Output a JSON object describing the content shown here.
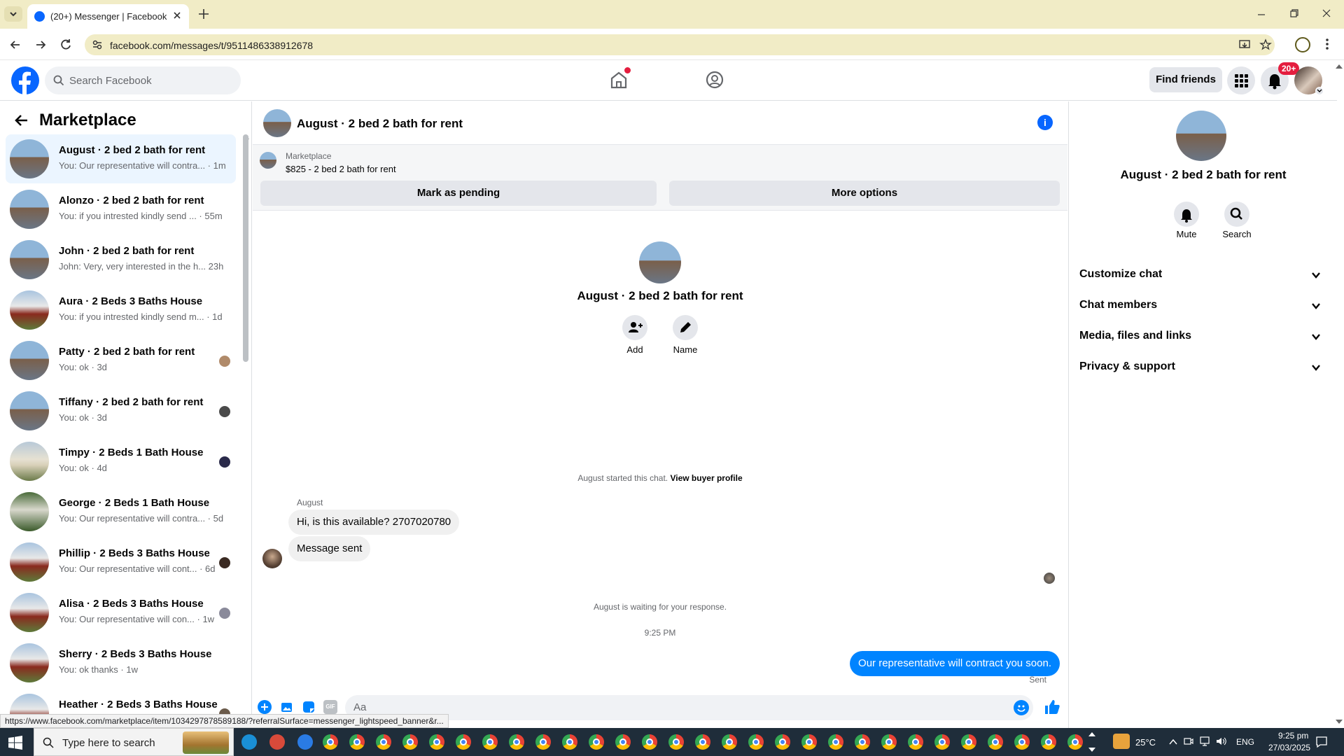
{
  "browser": {
    "tab_title": "(20+) Messenger | Facebook",
    "url": "facebook.com/messages/t/9511486338912678",
    "status_url": "https://www.facebook.com/marketplace/item/1034297878589188/?referralSurface=messenger_lightspeed_banner&r..."
  },
  "fb_header": {
    "search_placeholder": "Search Facebook",
    "find_friends": "Find friends",
    "notification_badge": "20+"
  },
  "left_panel": {
    "title": "Marketplace",
    "conversations": [
      {
        "name": "August · 2 bed 2 bath for rent",
        "preview": "You: Our representative will contra... · 1m"
      },
      {
        "name": "Alonzo · 2 bed 2 bath for rent",
        "preview": "You: if you intrested kindly send ... · 55m"
      },
      {
        "name": "John · 2 bed 2 bath for rent",
        "preview": "John: Very, very interested in the h... 23h"
      },
      {
        "name": "Aura · 2 Beds 3 Baths House",
        "preview": "You: if you intrested kindly send m... · 1d"
      },
      {
        "name": "Patty · 2 bed 2 bath for rent",
        "preview": "You: ok · 3d"
      },
      {
        "name": "Tiffany · 2 bed 2 bath for rent",
        "preview": "You: ok · 3d"
      },
      {
        "name": "Timpy · 2 Beds 1 Bath House",
        "preview": "You: ok · 4d"
      },
      {
        "name": "George · 2 Beds 1 Bath House",
        "preview": "You: Our representative will contra... · 5d"
      },
      {
        "name": "Phillip · 2 Beds 3 Baths House",
        "preview": "You: Our representative will cont... · 6d"
      },
      {
        "name": "Alisa · 2 Beds 3 Baths House",
        "preview": "You: Our representative will con... · 1w"
      },
      {
        "name": "Sherry · 2 Beds 3 Baths House",
        "preview": "You: ok thanks · 1w"
      },
      {
        "name": "Heather · 2 Beds 3 Baths House",
        "preview": ""
      }
    ]
  },
  "chat": {
    "title": "August · 2 bed 2 bath for rent",
    "marketplace_label": "Marketplace",
    "listing": "$825 - 2 bed 2 bath for rent",
    "mark_pending": "Mark as pending",
    "more_options": "More options",
    "profile_name": "August · 2 bed 2 bath for rent",
    "add_label": "Add",
    "name_label": "Name",
    "started_text": "August started this chat.",
    "view_buyer": "View buyer profile",
    "sender_name": "August",
    "msg1": "Hi, is this available? 2707020780",
    "msg2": "Message sent",
    "waiting": "August is waiting for your response.",
    "time": "9:25 PM",
    "my_msg": "Our representative will contract you soon.",
    "sent_label": "Sent",
    "composer_placeholder": "Aa"
  },
  "details": {
    "name": "August · 2 bed 2 bath for rent",
    "mute": "Mute",
    "search": "Search",
    "sections": [
      "Customize chat",
      "Chat members",
      "Media, files and links",
      "Privacy & support"
    ]
  },
  "taskbar": {
    "search_placeholder": "Type here to search",
    "temperature": "25°C",
    "language": "ENG",
    "clock_time": "9:25 pm",
    "clock_date": "27/03/2025"
  },
  "colors": {
    "fb_blue": "#0866ff",
    "messenger_blue": "#0084ff",
    "chrome_bar": "#f1ecc6",
    "taskbar": "#1f2d3a"
  }
}
